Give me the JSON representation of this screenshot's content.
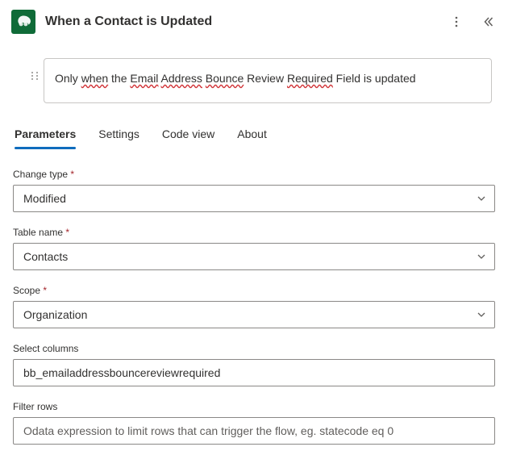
{
  "header": {
    "title": "When a Contact is Updated"
  },
  "note": {
    "plain": "Only when the Email Address Bounce Review Required Field is updated",
    "w1": "Only ",
    "w2": "when",
    "w3": " the ",
    "w4": "Email",
    "w5": " ",
    "w6": "Address",
    "w7": " ",
    "w8": "Bounce",
    "w9": " Review ",
    "w10": "Required",
    "w11": " Field is updated"
  },
  "tabs": {
    "parameters": "Parameters",
    "settings": "Settings",
    "code_view": "Code view",
    "about": "About"
  },
  "fields": {
    "change_type": {
      "label": "Change type",
      "value": "Modified"
    },
    "table_name": {
      "label": "Table name",
      "value": "Contacts"
    },
    "scope": {
      "label": "Scope",
      "value": "Organization"
    },
    "select_columns": {
      "label": "Select columns",
      "value": "bb_emailaddressbouncereviewrequired"
    },
    "filter_rows": {
      "label": "Filter rows",
      "value": "",
      "placeholder": "Odata expression to limit rows that can trigger the flow, eg. statecode eq 0"
    }
  }
}
